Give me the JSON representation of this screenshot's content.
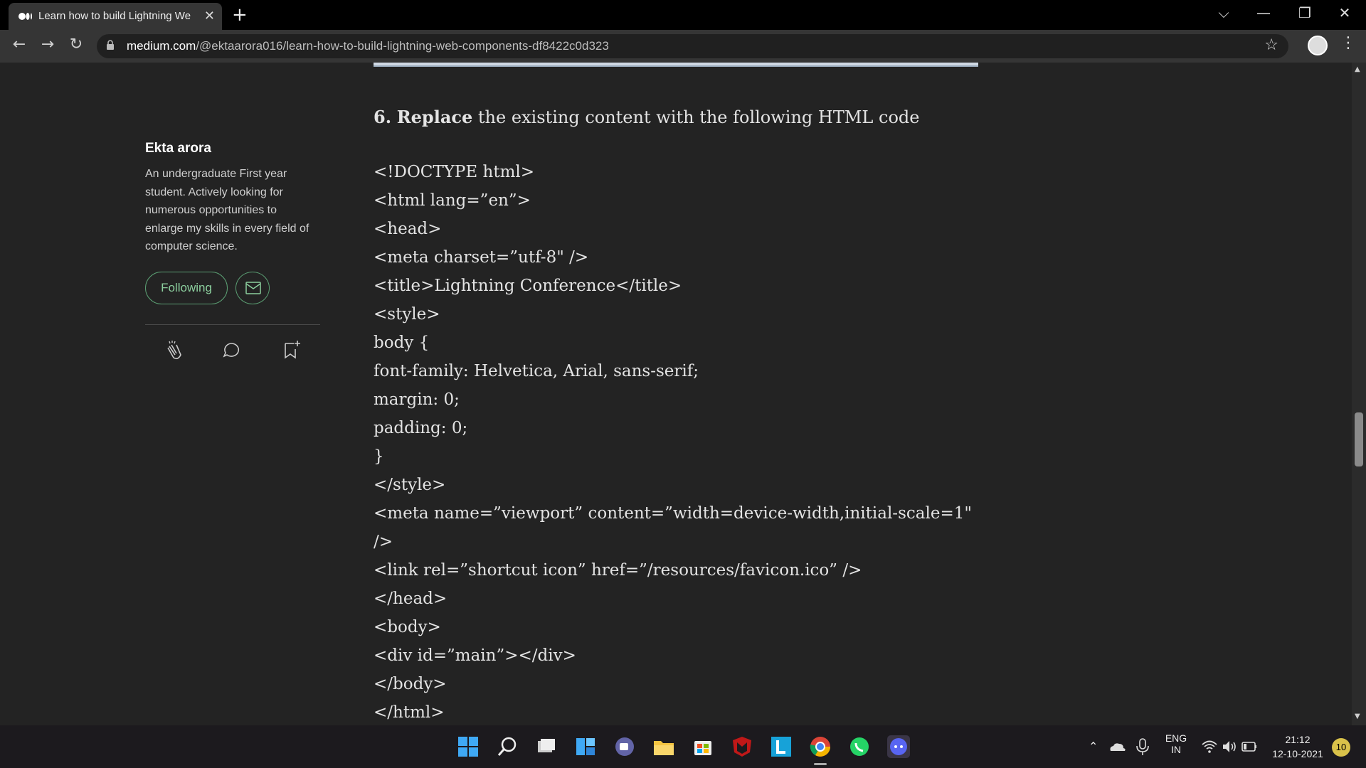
{
  "browser": {
    "tab_title": "Learn how to build Lightning We",
    "url_host": "medium.com",
    "url_path": "/@ektaarora016/learn-how-to-build-lightning-web-components-df8422c0d323"
  },
  "sidebar": {
    "author_name": "Ekta arora",
    "author_bio": "An undergraduate First year student. Actively looking for numerous opportunities to enlarge my skills in every field of computer science.",
    "following_label": "Following"
  },
  "article": {
    "step_number": "6.",
    "step_verb": "Replace",
    "step_rest": " the existing content with the following HTML code",
    "code_lines": [
      "<!DOCTYPE html>",
      "<html lang=”en”>",
      "<head>",
      "<meta charset=”utf-8\" />",
      "<title>Lightning Conference</title>",
      "<style>",
      "body {",
      "font-family: Helvetica, Arial, sans-serif;",
      "margin: 0;",
      "padding: 0;",
      "}",
      "</style>",
      "<meta name=”viewport” content=”width=device-width,initial-scale=1\"",
      "/>",
      "<link rel=”shortcut icon” href=”/resources/favicon.ico” />",
      "</head>",
      "<body>",
      "<div id=”main”></div>",
      "</body>",
      "</html>"
    ]
  },
  "taskbar": {
    "lang_top": "ENG",
    "lang_bottom": "IN",
    "time": "21:12",
    "date": "12-10-2021",
    "notification_count": "10"
  },
  "colors": {
    "accent_green": "#5b9f73",
    "page_bg": "#232323"
  }
}
